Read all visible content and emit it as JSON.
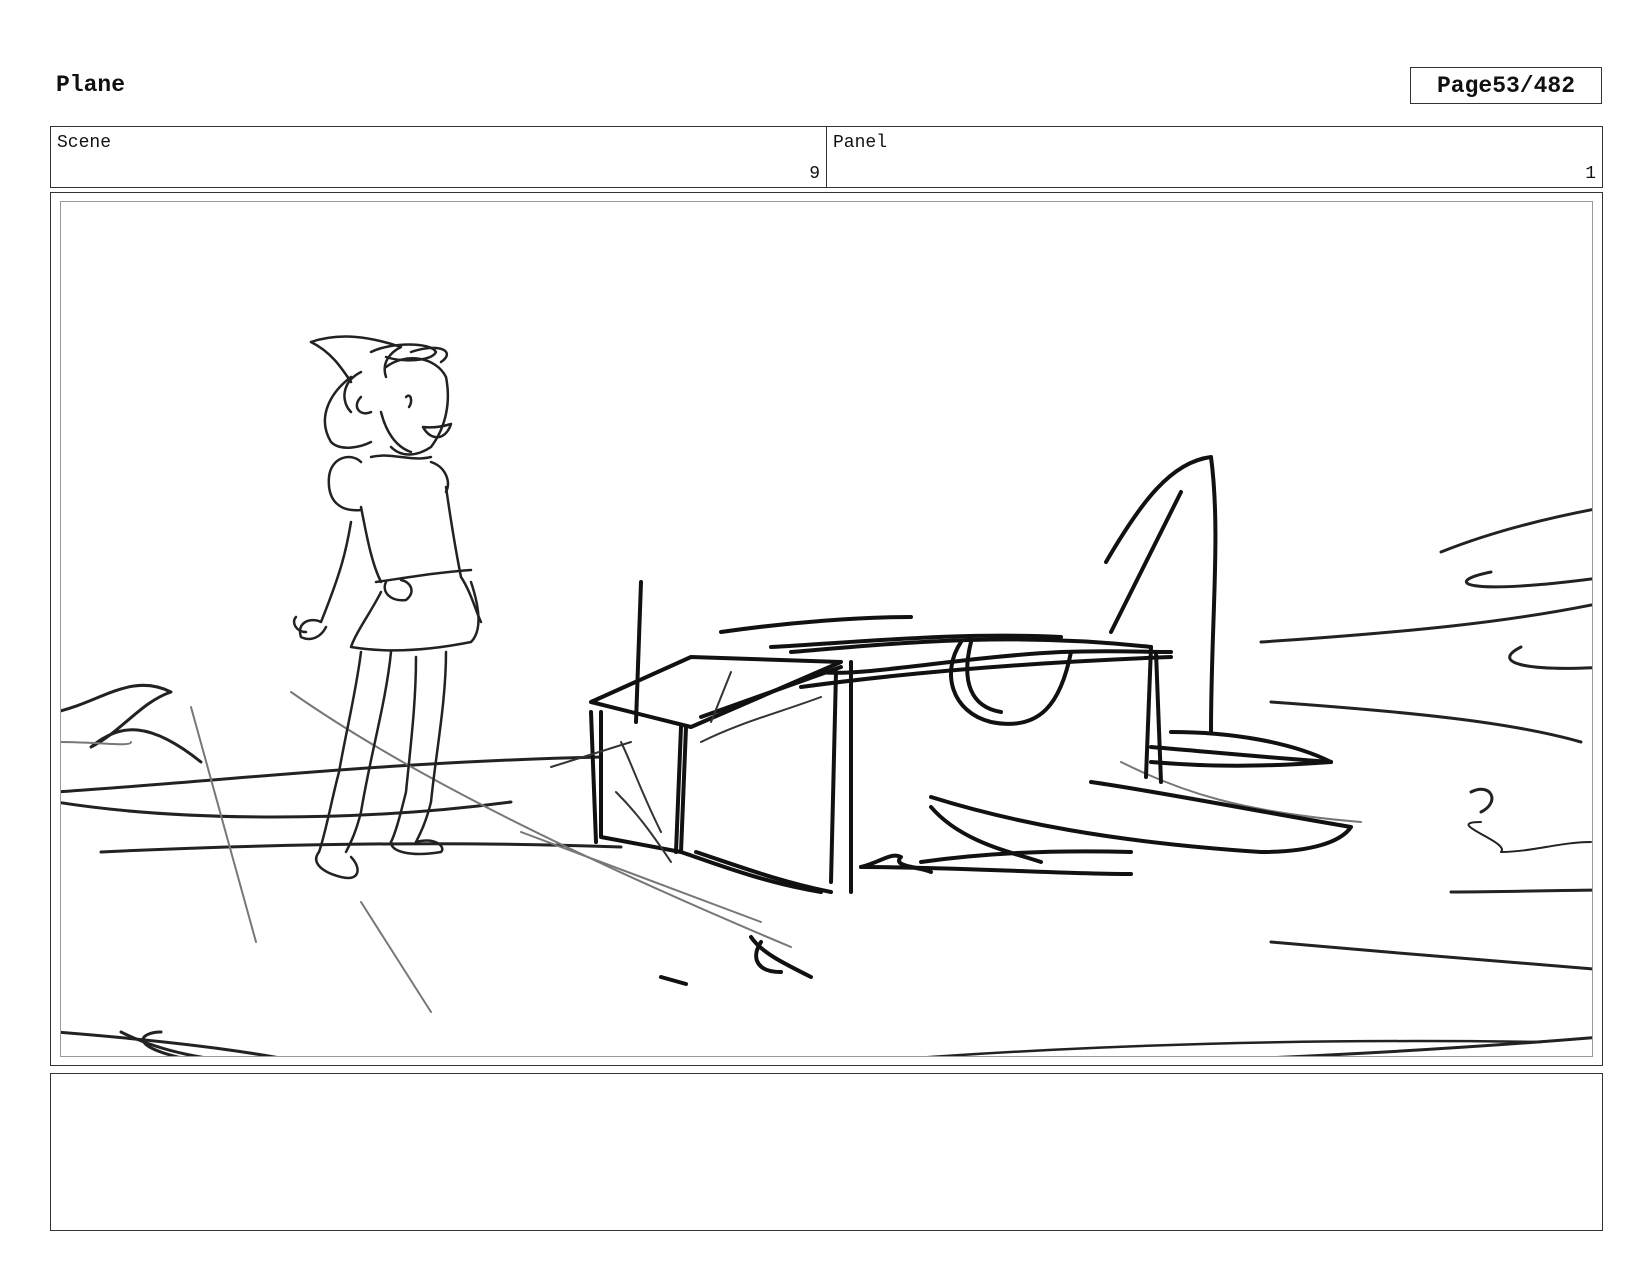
{
  "header": {
    "project_title": "Plane",
    "page_label": "Page",
    "page_number": "53/482"
  },
  "info": {
    "scene_label": "Scene",
    "scene_value": "9",
    "panel_label": "Panel",
    "panel_value": "1"
  },
  "notes": {
    "text": ""
  }
}
